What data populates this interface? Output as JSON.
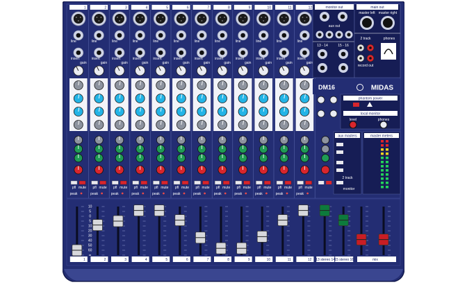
{
  "device": {
    "brand": "MIDAS",
    "model": "DM16",
    "colors": {
      "panel": "#232d73",
      "panel_dark": "#161d55",
      "silver": "#cfd4e6",
      "white_strip": "#f2f3f8",
      "eq_cyan": "#23b4e6",
      "aux_green": "#1f9a55",
      "pan_red": "#d8262d",
      "fader_green": "#0d7a3c",
      "fader_red": "#c81d24",
      "led_green": "#23d35a",
      "led_yellow": "#f0d21e",
      "led_red": "#e0242a"
    }
  },
  "channels": [
    {
      "number": "1",
      "input": "line",
      "insert": "insert",
      "gain": "gain",
      "pfl": "pfl",
      "mute": "mute",
      "peak": "peak",
      "fader": 0.1
    },
    {
      "number": "2",
      "input": "line",
      "insert": "insert",
      "gain": "gain",
      "pfl": "pfl",
      "mute": "mute",
      "peak": "peak",
      "fader": 0.62
    },
    {
      "number": "3",
      "input": "line",
      "insert": "insert",
      "gain": "gain",
      "pfl": "pfl",
      "mute": "mute",
      "peak": "peak",
      "fader": 0.7
    },
    {
      "number": "4",
      "input": "line",
      "insert": "insert",
      "gain": "gain",
      "pfl": "pfl",
      "mute": "mute",
      "peak": "peak",
      "fader": 0.92
    },
    {
      "number": "5",
      "input": "line",
      "insert": "insert",
      "gain": "gain",
      "pfl": "pfl",
      "mute": "mute",
      "peak": "peak",
      "fader": 0.92
    },
    {
      "number": "6",
      "input": "line",
      "insert": "insert",
      "gain": "gain",
      "pfl": "pfl",
      "mute": "mute",
      "peak": "peak",
      "fader": 0.72
    },
    {
      "number": "7",
      "input": "line",
      "insert": "insert",
      "gain": "gain",
      "pfl": "pfl",
      "mute": "mute",
      "peak": "peak",
      "fader": 0.36
    },
    {
      "number": "8",
      "input": "line",
      "insert": "insert",
      "gain": "gain",
      "pfl": "pfl",
      "mute": "mute",
      "peak": "peak",
      "fader": 0.14
    },
    {
      "number": "9",
      "input": "line",
      "insert": "insert",
      "gain": "gain",
      "pfl": "pfl",
      "mute": "mute",
      "peak": "peak",
      "fader": 0.14
    },
    {
      "number": "10",
      "input": "line",
      "insert": "insert",
      "gain": "gain",
      "pfl": "pfl",
      "mute": "mute",
      "peak": "peak",
      "fader": 0.38
    },
    {
      "number": "11",
      "input": "line",
      "insert": "insert",
      "gain": "gain",
      "pfl": "pfl",
      "mute": "mute",
      "peak": "peak",
      "fader": 0.72
    },
    {
      "number": "12",
      "input": "line",
      "insert": "insert",
      "gain": "gain",
      "pfl": "pfl",
      "mute": "mute",
      "peak": "peak",
      "fader": 0.92
    }
  ],
  "stereo_channels": [
    {
      "number": "13 stereo 14",
      "fader": 0.92
    },
    {
      "number": "15 stereo 16",
      "fader": 0.72
    }
  ],
  "mix_fader": {
    "label": "mix",
    "fader": 0.32
  },
  "fader_scale": [
    "10",
    "5",
    "0",
    "5",
    "10",
    "20",
    "30",
    "40",
    "50",
    "60",
    "∞"
  ],
  "master_section": {
    "monitor_out": "monitor out",
    "aux_out": "aux out",
    "main_out": "main out",
    "master_left": "master left",
    "master_right": "master right",
    "ch_13_14": "13 - 14",
    "ch_15_16": "15 - 16",
    "two_track": "2 track",
    "phones": "phones",
    "record_out": "record out",
    "phantom_power": "phantom power",
    "local_monitor": "local monitor",
    "level": "level",
    "aux_masters": "aux masters",
    "master_meters": "master meters",
    "monitor": "monitor"
  }
}
